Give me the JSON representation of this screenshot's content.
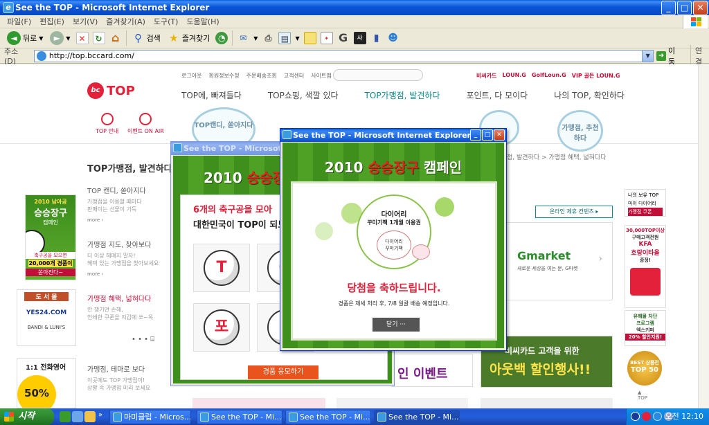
{
  "window": {
    "title": "See the TOP - Microsoft Internet Explorer",
    "buttons": {
      "minimize": "_",
      "maximize": "□",
      "close": "✕"
    }
  },
  "menubar": [
    "파일(F)",
    "편집(E)",
    "보기(V)",
    "즐겨찾기(A)",
    "도구(T)",
    "도움말(H)"
  ],
  "toolbar": {
    "back": "뒤로",
    "search": "검색",
    "favorites": "즐겨찾기"
  },
  "address": {
    "label": "주소(D)",
    "url": "http://top.bccard.com/",
    "go": "이동",
    "links": "연결"
  },
  "site": {
    "util": [
      "로그아웃",
      "회원정보수정",
      "주문배송조회",
      "고객센터",
      "사이트맵"
    ],
    "brand_links": [
      "비씨카드",
      "LOUN.G",
      "GolfLoun.G",
      "VIP 골든 LOUN.G"
    ],
    "logo": "TOP",
    "gnb": [
      "TOP에, 빠져들다",
      "TOP쇼핑, 색깔 있다",
      "TOP가맹점, 발견하다",
      "포인트, 다 모이다",
      "나의 TOP, 확인하다"
    ],
    "quick": [
      "TOP 안내",
      "이벤트 ON AIR"
    ],
    "bubbles": [
      "TOP캔디, 쏟아지다",
      "가맹점, 추천하다"
    ],
    "breadcrumb": "점, 발견하다 > 가맹점 혜택, 넓혀다다",
    "section_title": "TOP가맹점, 발견하다",
    "categories": [
      {
        "title": "TOP 캔디, 쏟아지다",
        "desc": "가맹점을 이용할 때마다\n판매이는 선물이 가득",
        "more": "more ›"
      },
      {
        "title": "가맹점 지도, 찾아보다",
        "desc": "더 이상 헤매지 말자!\n혜택 있는 가맹점을 찾아보세요",
        "more": "more ›"
      },
      {
        "title": "가맹점 혜택, 넓혀다다",
        "desc": "안 챙기면 손해,\n인쇄한 쿠폰을 지갑에 쏘~옥",
        "more": "more ›"
      },
      {
        "title": "가맹점, 테마로 보다",
        "desc": "이곳에도 TOP 가맹점이!\n상황 속 가맹점 미리 보세요",
        "more": ""
      }
    ],
    "left_banners": {
      "soccer": [
        "2010 남아공",
        "승승장구",
        "캠페인",
        "축구공을 모으면",
        "20,000개 경품이",
        "쏟아진다~"
      ],
      "books": [
        "도 서 몰",
        "YES24.COM",
        "BANDI & LUNI'S"
      ],
      "english": [
        "1:1 전화영어",
        "50%"
      ]
    },
    "online_content": "온라인 제휴 컨텐츠",
    "gmarket": {
      "logo": "Gmarket",
      "tagline": "새로운 세상을 여는 문, G마켓"
    },
    "outback": {
      "top": "비씨카드 고객을 위한",
      "main": "아웃백 할인행사!!"
    },
    "event_strip": "인 이벤트",
    "right_side": {
      "menu": [
        "나의 보유 TOP",
        "마이 다이어리",
        "가맹점 쿠폰"
      ],
      "kfa": [
        "30,000TOP이상",
        "구매고객전원",
        "KFA",
        "호랑이타올",
        "증정!"
      ],
      "virus": [
        "유해물 차단",
        "프로그램",
        "엑스키퍼",
        "20% 할인지원!"
      ],
      "best": [
        "BEST 상품전",
        "TOP 50"
      ],
      "top_label": "TOP"
    }
  },
  "popup_back": {
    "title": "See the TOP - Microsoft Internet Explorer",
    "campaign_year": "2010",
    "campaign_name": "승승장구",
    "headline1": "6개의 축구공을 모아",
    "headline2": "대한민국이 TOP이 되도",
    "balls": [
      "T",
      "O",
      "포",
      "P"
    ],
    "apply_button": "경품 응모하기"
  },
  "popup_front": {
    "title": "See the TOP - Microsoft Internet Explorer",
    "campaign_year": "2010",
    "campaign_name": "승승장구",
    "campaign_suffix": "캠페인",
    "prize_line1": "다이어리",
    "prize_line2": "꾸미기팩 1개월 이용권",
    "prize_sticker1": "다이어리",
    "prize_sticker2": "꾸미기팩",
    "congrats": "당첨을 축하드립니다.",
    "notice": "경품은 제세 처리 후, 7/8 일괄 배송 예정입니다.",
    "close_button": "닫기"
  },
  "taskbar": {
    "start": "시작",
    "tasks": [
      "마미클럽 - Micros...",
      "See the TOP - Mi...",
      "See the TOP - Mi...",
      "See the TOP - Mi..."
    ],
    "clock": "오전 12:10"
  },
  "colors": {
    "brand_red": "#e3213a",
    "title_blue": "#0a55d8",
    "grass": "#3f8f1c"
  }
}
